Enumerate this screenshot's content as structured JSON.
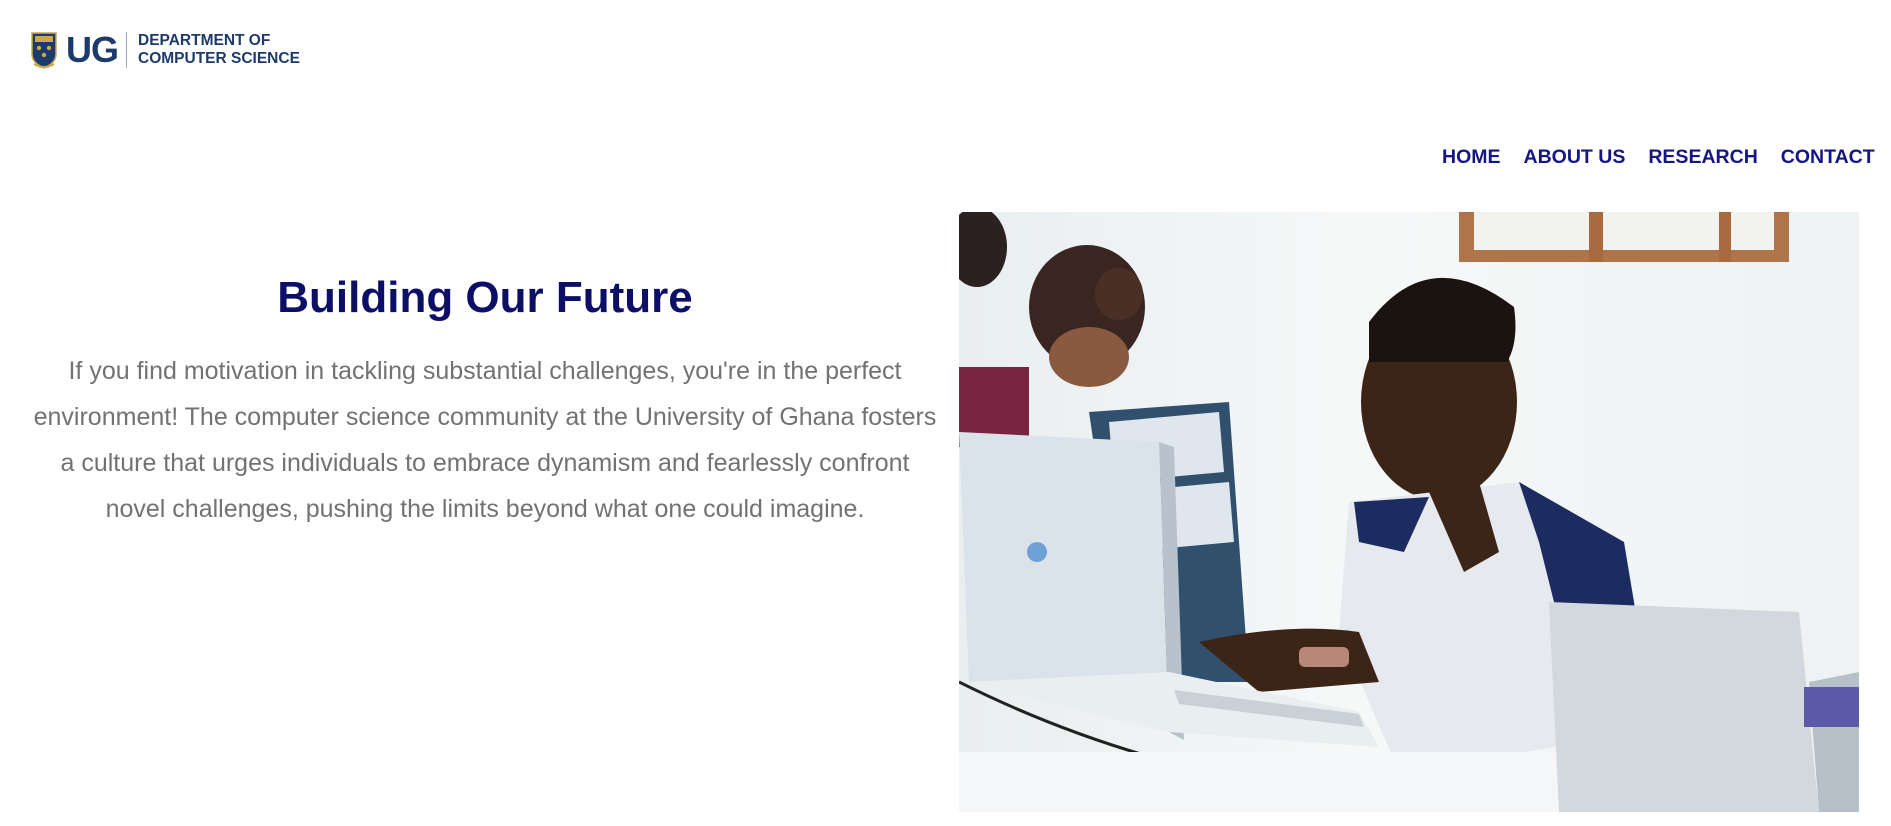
{
  "header": {
    "logo_abbrev": "UG",
    "dept_line1": "DEPARTMENT OF",
    "dept_line2": "COMPUTER SCIENCE",
    "brand_color": "#1d3a6b"
  },
  "nav": {
    "items": [
      {
        "label": "HOME"
      },
      {
        "label": "ABOUT US"
      },
      {
        "label": "RESEARCH"
      },
      {
        "label": "CONTACT"
      }
    ],
    "color": "#151585"
  },
  "hero": {
    "title": "Building Our Future",
    "body": "If you find motivation in tackling substantial challenges, you're in the perfect environment! The computer science community at the University of Ghana fosters a culture that urges individuals to embrace dynamism and fearlessly confront novel challenges, pushing the limits beyond what one could imagine.",
    "title_color": "#0d0f66",
    "body_color": "#727272"
  },
  "icons": {
    "crest": "university-crest-icon"
  }
}
